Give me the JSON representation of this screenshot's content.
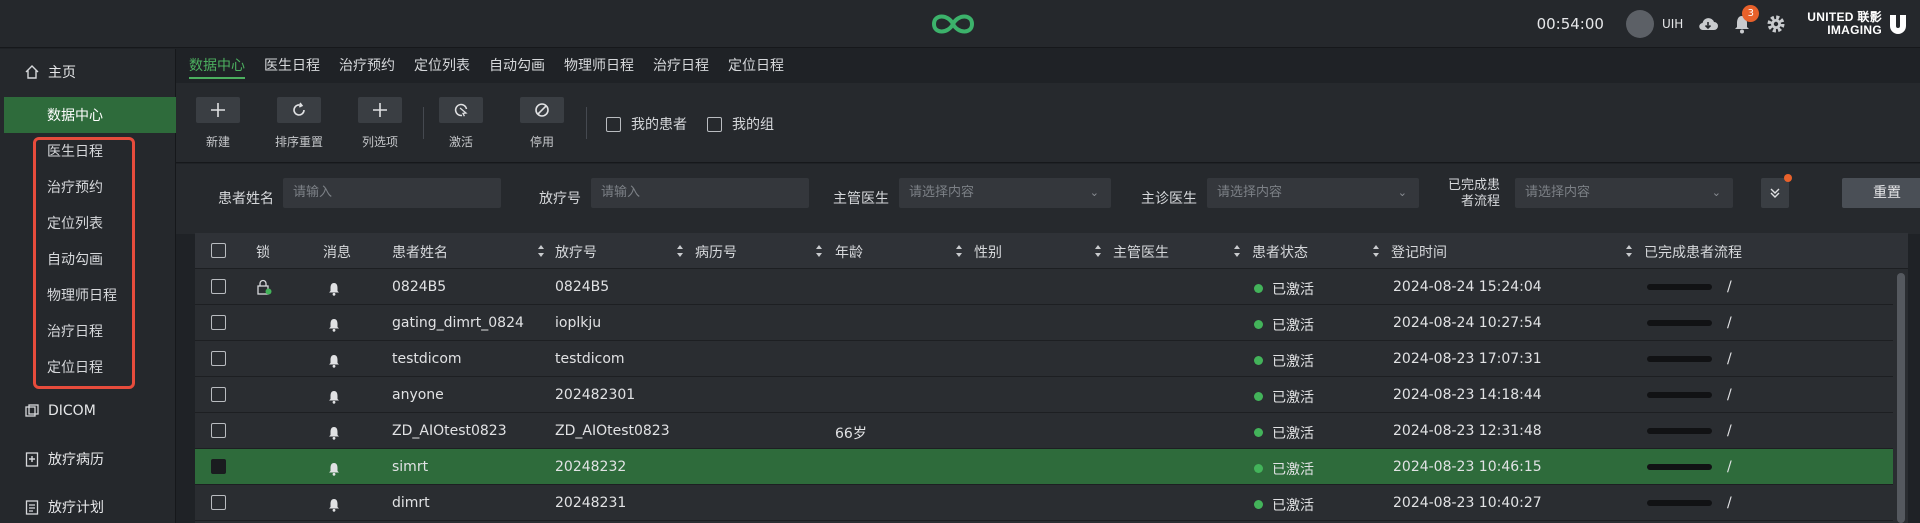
{
  "header": {
    "clock": "00:54:00",
    "username": "UIH",
    "notification_count": "3",
    "brand_line1": "UNITED 联影",
    "brand_line2": "IMAGING",
    "accent_color": "#4caf5f",
    "logo_color": "#3cb26b"
  },
  "sidebar": {
    "home_label": "主页",
    "items": [
      {
        "label": "数据中心",
        "active": true
      },
      {
        "label": "医生日程"
      },
      {
        "label": "治疗预约"
      },
      {
        "label": "定位列表"
      },
      {
        "label": "自动勾画"
      },
      {
        "label": "物理师日程"
      },
      {
        "label": "治疗日程"
      },
      {
        "label": "定位日程"
      }
    ],
    "sections": [
      {
        "label": "DICOM",
        "icon": "dicom-icon"
      },
      {
        "label": "放疗病历",
        "icon": "medical-record-icon"
      },
      {
        "label": "放疗计划",
        "icon": "plan-icon"
      }
    ]
  },
  "tabs": [
    "数据中心",
    "医生日程",
    "治疗预约",
    "定位列表",
    "自动勾画",
    "物理师日程",
    "治疗日程",
    "定位日程"
  ],
  "toolbar": {
    "new": "新建",
    "reset_order": "排序重置",
    "columns": "列选项",
    "activate": "激活",
    "disable": "停用",
    "my_patients": "我的患者",
    "my_group": "我的组"
  },
  "filters": {
    "patient_name_label": "患者姓名",
    "patient_name_placeholder": "请输入",
    "rt_no_label": "放疗号",
    "rt_no_placeholder": "请输入",
    "attending_label": "主管医生",
    "attending_placeholder": "请选择内容",
    "diagnosing_label": "主诊医生",
    "diagnosing_placeholder": "请选择内容",
    "completed_label_1": "已完成患",
    "completed_label_2": "者流程",
    "completed_placeholder": "请选择内容",
    "reset": "重置"
  },
  "table": {
    "columns": [
      "锁",
      "消息",
      "患者姓名",
      "放疗号",
      "病历号",
      "年龄",
      "性别",
      "主管医生",
      "患者状态",
      "登记时间",
      "已完成患者流程"
    ],
    "rows": [
      {
        "name": "0824B5",
        "rt_no": "0824B5",
        "record_no": "",
        "age": "",
        "gender": "",
        "doctor": "",
        "status": "已激活",
        "time": "2024-08-24 15:24:04",
        "flow": "/",
        "locked": true,
        "selected": false
      },
      {
        "name": "gating_dimrt_0824",
        "rt_no": "ioplkju",
        "record_no": "",
        "age": "",
        "gender": "",
        "doctor": "",
        "status": "已激活",
        "time": "2024-08-24 10:27:54",
        "flow": "/",
        "locked": false,
        "selected": false
      },
      {
        "name": "testdicom",
        "rt_no": "testdicom",
        "record_no": "",
        "age": "",
        "gender": "",
        "doctor": "",
        "status": "已激活",
        "time": "2024-08-23 17:07:31",
        "flow": "/",
        "locked": false,
        "selected": false
      },
      {
        "name": "anyone",
        "rt_no": "202482301",
        "record_no": "",
        "age": "",
        "gender": "",
        "doctor": "",
        "status": "已激活",
        "time": "2024-08-23 14:18:44",
        "flow": "/",
        "locked": false,
        "selected": false
      },
      {
        "name": "ZD_AIOtest0823",
        "rt_no": "ZD_AIOtest0823",
        "record_no": "",
        "age": "66岁",
        "gender": "",
        "doctor": "",
        "status": "已激活",
        "time": "2024-08-23 12:31:48",
        "flow": "/",
        "locked": false,
        "selected": false
      },
      {
        "name": "simrt",
        "rt_no": "20248232",
        "record_no": "",
        "age": "",
        "gender": "",
        "doctor": "",
        "status": "已激活",
        "time": "2024-08-23 10:46:15",
        "flow": "/",
        "locked": false,
        "selected": true
      },
      {
        "name": "dimrt",
        "rt_no": "20248231",
        "record_no": "",
        "age": "",
        "gender": "",
        "doctor": "",
        "status": "已激活",
        "time": "2024-08-23 10:40:27",
        "flow": "/",
        "locked": false,
        "selected": false
      }
    ]
  }
}
